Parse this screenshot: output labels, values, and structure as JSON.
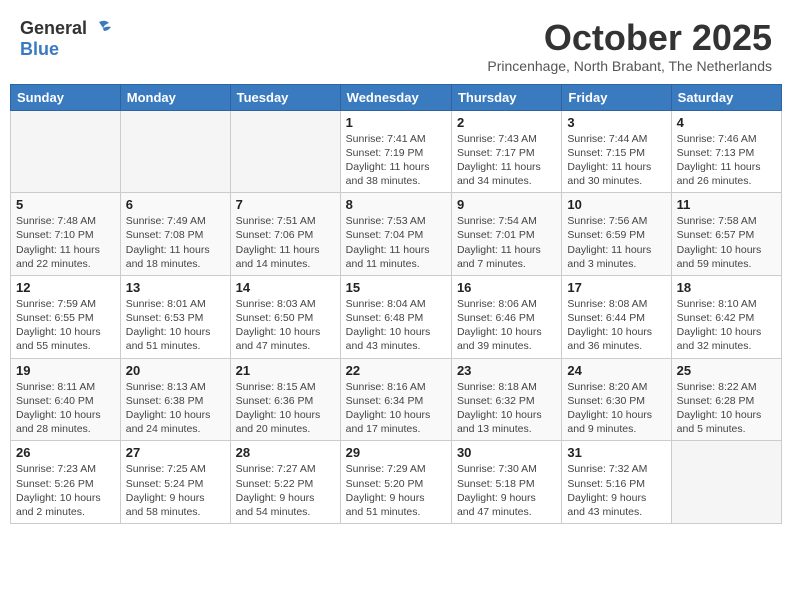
{
  "logo": {
    "general": "General",
    "blue": "Blue",
    "bird_icon": "▶"
  },
  "header": {
    "month": "October 2025",
    "subtitle": "Princenhage, North Brabant, The Netherlands"
  },
  "weekdays": [
    "Sunday",
    "Monday",
    "Tuesday",
    "Wednesday",
    "Thursday",
    "Friday",
    "Saturday"
  ],
  "weeks": [
    [
      {
        "day": "",
        "info": ""
      },
      {
        "day": "",
        "info": ""
      },
      {
        "day": "",
        "info": ""
      },
      {
        "day": "1",
        "info": "Sunrise: 7:41 AM\nSunset: 7:19 PM\nDaylight: 11 hours\nand 38 minutes."
      },
      {
        "day": "2",
        "info": "Sunrise: 7:43 AM\nSunset: 7:17 PM\nDaylight: 11 hours\nand 34 minutes."
      },
      {
        "day": "3",
        "info": "Sunrise: 7:44 AM\nSunset: 7:15 PM\nDaylight: 11 hours\nand 30 minutes."
      },
      {
        "day": "4",
        "info": "Sunrise: 7:46 AM\nSunset: 7:13 PM\nDaylight: 11 hours\nand 26 minutes."
      }
    ],
    [
      {
        "day": "5",
        "info": "Sunrise: 7:48 AM\nSunset: 7:10 PM\nDaylight: 11 hours\nand 22 minutes."
      },
      {
        "day": "6",
        "info": "Sunrise: 7:49 AM\nSunset: 7:08 PM\nDaylight: 11 hours\nand 18 minutes."
      },
      {
        "day": "7",
        "info": "Sunrise: 7:51 AM\nSunset: 7:06 PM\nDaylight: 11 hours\nand 14 minutes."
      },
      {
        "day": "8",
        "info": "Sunrise: 7:53 AM\nSunset: 7:04 PM\nDaylight: 11 hours\nand 11 minutes."
      },
      {
        "day": "9",
        "info": "Sunrise: 7:54 AM\nSunset: 7:01 PM\nDaylight: 11 hours\nand 7 minutes."
      },
      {
        "day": "10",
        "info": "Sunrise: 7:56 AM\nSunset: 6:59 PM\nDaylight: 11 hours\nand 3 minutes."
      },
      {
        "day": "11",
        "info": "Sunrise: 7:58 AM\nSunset: 6:57 PM\nDaylight: 10 hours\nand 59 minutes."
      }
    ],
    [
      {
        "day": "12",
        "info": "Sunrise: 7:59 AM\nSunset: 6:55 PM\nDaylight: 10 hours\nand 55 minutes."
      },
      {
        "day": "13",
        "info": "Sunrise: 8:01 AM\nSunset: 6:53 PM\nDaylight: 10 hours\nand 51 minutes."
      },
      {
        "day": "14",
        "info": "Sunrise: 8:03 AM\nSunset: 6:50 PM\nDaylight: 10 hours\nand 47 minutes."
      },
      {
        "day": "15",
        "info": "Sunrise: 8:04 AM\nSunset: 6:48 PM\nDaylight: 10 hours\nand 43 minutes."
      },
      {
        "day": "16",
        "info": "Sunrise: 8:06 AM\nSunset: 6:46 PM\nDaylight: 10 hours\nand 39 minutes."
      },
      {
        "day": "17",
        "info": "Sunrise: 8:08 AM\nSunset: 6:44 PM\nDaylight: 10 hours\nand 36 minutes."
      },
      {
        "day": "18",
        "info": "Sunrise: 8:10 AM\nSunset: 6:42 PM\nDaylight: 10 hours\nand 32 minutes."
      }
    ],
    [
      {
        "day": "19",
        "info": "Sunrise: 8:11 AM\nSunset: 6:40 PM\nDaylight: 10 hours\nand 28 minutes."
      },
      {
        "day": "20",
        "info": "Sunrise: 8:13 AM\nSunset: 6:38 PM\nDaylight: 10 hours\nand 24 minutes."
      },
      {
        "day": "21",
        "info": "Sunrise: 8:15 AM\nSunset: 6:36 PM\nDaylight: 10 hours\nand 20 minutes."
      },
      {
        "day": "22",
        "info": "Sunrise: 8:16 AM\nSunset: 6:34 PM\nDaylight: 10 hours\nand 17 minutes."
      },
      {
        "day": "23",
        "info": "Sunrise: 8:18 AM\nSunset: 6:32 PM\nDaylight: 10 hours\nand 13 minutes."
      },
      {
        "day": "24",
        "info": "Sunrise: 8:20 AM\nSunset: 6:30 PM\nDaylight: 10 hours\nand 9 minutes."
      },
      {
        "day": "25",
        "info": "Sunrise: 8:22 AM\nSunset: 6:28 PM\nDaylight: 10 hours\nand 5 minutes."
      }
    ],
    [
      {
        "day": "26",
        "info": "Sunrise: 7:23 AM\nSunset: 5:26 PM\nDaylight: 10 hours\nand 2 minutes."
      },
      {
        "day": "27",
        "info": "Sunrise: 7:25 AM\nSunset: 5:24 PM\nDaylight: 9 hours\nand 58 minutes."
      },
      {
        "day": "28",
        "info": "Sunrise: 7:27 AM\nSunset: 5:22 PM\nDaylight: 9 hours\nand 54 minutes."
      },
      {
        "day": "29",
        "info": "Sunrise: 7:29 AM\nSunset: 5:20 PM\nDaylight: 9 hours\nand 51 minutes."
      },
      {
        "day": "30",
        "info": "Sunrise: 7:30 AM\nSunset: 5:18 PM\nDaylight: 9 hours\nand 47 minutes."
      },
      {
        "day": "31",
        "info": "Sunrise: 7:32 AM\nSunset: 5:16 PM\nDaylight: 9 hours\nand 43 minutes."
      },
      {
        "day": "",
        "info": ""
      }
    ]
  ]
}
